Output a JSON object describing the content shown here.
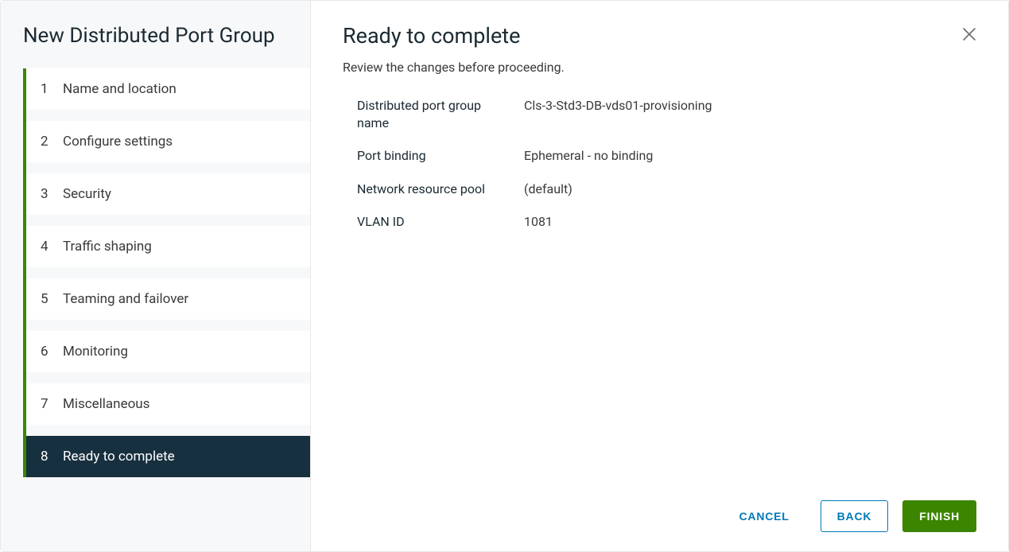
{
  "wizard": {
    "title": "New Distributed Port Group",
    "steps": [
      {
        "num": "1",
        "label": "Name and location"
      },
      {
        "num": "2",
        "label": "Configure settings"
      },
      {
        "num": "3",
        "label": "Security"
      },
      {
        "num": "4",
        "label": "Traffic shaping"
      },
      {
        "num": "5",
        "label": "Teaming and failover"
      },
      {
        "num": "6",
        "label": "Monitoring"
      },
      {
        "num": "7",
        "label": "Miscellaneous"
      },
      {
        "num": "8",
        "label": "Ready to complete"
      }
    ],
    "active_step_index": 7
  },
  "content": {
    "title": "Ready to complete",
    "subtitle": "Review the changes before proceeding.",
    "summary": [
      {
        "label": "Distributed port group name",
        "value": "Cls-3-Std3-DB-vds01-provisioning"
      },
      {
        "label": "Port binding",
        "value": "Ephemeral - no binding"
      },
      {
        "label": "Network resource pool",
        "value": "(default)"
      },
      {
        "label": "VLAN ID",
        "value": "1081"
      }
    ]
  },
  "footer": {
    "cancel": "Cancel",
    "back": "Back",
    "finish": "Finish"
  }
}
